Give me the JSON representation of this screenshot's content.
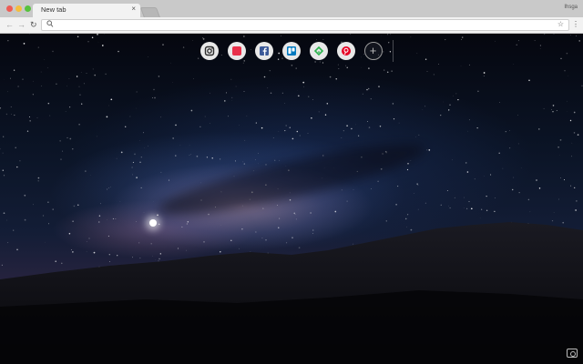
{
  "browser": {
    "tab_title": "New tab",
    "tab_close": "×",
    "profile_label": "Ihsga",
    "nav": {
      "back": "←",
      "forward": "→",
      "reload": "↻"
    },
    "omnibox": {
      "value": "",
      "placeholder": ""
    },
    "icons": {
      "search": "search-icon",
      "star": "star-icon",
      "menu": "menu-icon"
    }
  },
  "shortcuts": [
    {
      "name": "instagram",
      "icon": "instagram-icon",
      "color": "#2b2b2b"
    },
    {
      "name": "deals",
      "icon": "tag-icon",
      "color": "#e8304a"
    },
    {
      "name": "facebook",
      "icon": "facebook-icon",
      "color": "#3b5998"
    },
    {
      "name": "trello",
      "icon": "trello-icon",
      "color": "#0079bf"
    },
    {
      "name": "feedly",
      "icon": "feedly-icon",
      "color": "#2bb24c"
    },
    {
      "name": "pinterest",
      "icon": "pinterest-icon",
      "color": "#e60023"
    }
  ],
  "add_shortcut": "+",
  "wallpaper": {
    "description_icon": "camera-icon"
  }
}
